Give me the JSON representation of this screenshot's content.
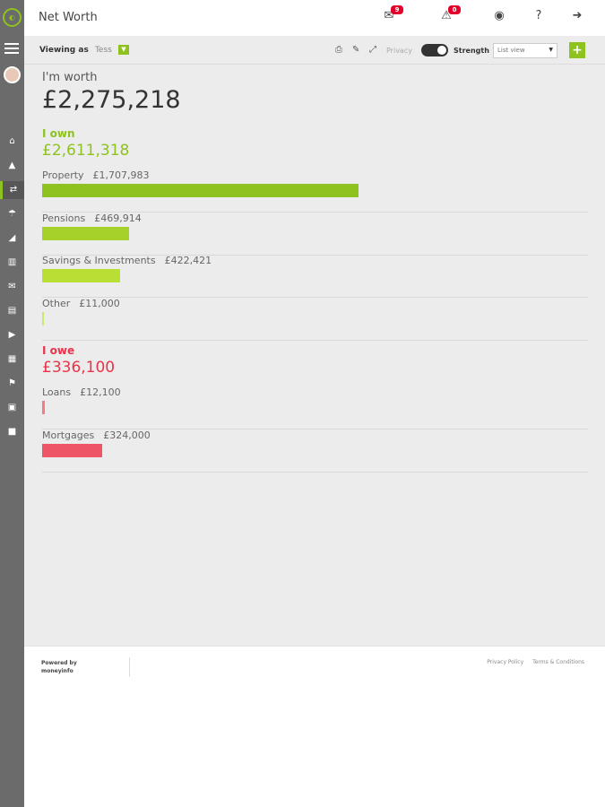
{
  "header": {
    "title": "Net Worth",
    "messages_badge": "9",
    "alerts_badge": "0"
  },
  "toolbar": {
    "viewing_label": "Viewing as",
    "viewing_name": "Tess",
    "privacy_label": "Privacy",
    "strength_label": "Strength",
    "view_select_value": "List view",
    "add_label": "+"
  },
  "summary": {
    "worth_label": "I'm worth",
    "worth_value": "£2,275,218"
  },
  "own": {
    "title": "I own",
    "total": "£2,611,318",
    "items": [
      {
        "label": "Property",
        "amount": "£1,707,983",
        "fill": 0.58,
        "color": "#8dc21f"
      },
      {
        "label": "Pensions",
        "amount": "£469,914",
        "fill": 0.16,
        "color": "#a6d12a"
      },
      {
        "label": "Savings & Investments",
        "amount": "£422,421",
        "fill": 0.143,
        "color": "#b9df35"
      },
      {
        "label": "Other",
        "amount": "£11,000",
        "fill": 0.003,
        "color": "#c8e86a"
      }
    ]
  },
  "owe": {
    "title": "I owe",
    "total": "£336,100",
    "items": [
      {
        "label": "Loans",
        "amount": "£12,100",
        "fill": 0.005,
        "color": "#f47a85"
      },
      {
        "label": "Mortgages",
        "amount": "£324,000",
        "fill": 0.11,
        "color": "#ee5566"
      }
    ]
  },
  "footer": {
    "powered_line1": "Powered by",
    "powered_line2": "moneyinfo",
    "privacy_policy": "Privacy Policy",
    "terms": "Terms & Conditions"
  },
  "colors": {
    "accent": "#8dc21f",
    "own": "#8dc21f",
    "owe": "#e8344a",
    "sidebar": "#6b6b6b"
  },
  "icons": {
    "sidebar": [
      "home-icon",
      "bank-icon",
      "transfer-icon",
      "umbrella-icon",
      "chart-area-icon",
      "bar-chart-icon",
      "mail-icon",
      "document-icon",
      "video-icon",
      "calendar-icon",
      "flag-icon",
      "archive-icon",
      "briefcase-icon"
    ]
  }
}
